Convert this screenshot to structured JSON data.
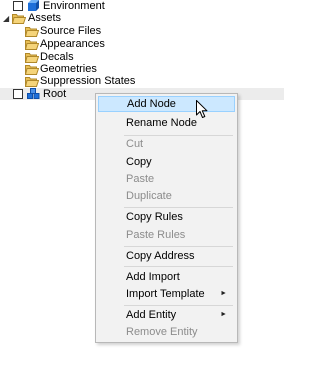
{
  "tree": {
    "environment": {
      "label": "Environment"
    },
    "assets": {
      "label": "Assets",
      "expander": "◢"
    },
    "children": [
      {
        "label": "Source Files"
      },
      {
        "label": "Appearances"
      },
      {
        "label": "Decals"
      },
      {
        "label": "Geometries"
      },
      {
        "label": "Suppression States"
      }
    ],
    "root": {
      "label": "Root"
    }
  },
  "context_menu": {
    "add_node": "Add Node",
    "rename_node": "Rename Node",
    "cut": "Cut",
    "copy": "Copy",
    "paste": "Paste",
    "duplicate": "Duplicate",
    "copy_rules": "Copy Rules",
    "paste_rules": "Paste Rules",
    "copy_address": "Copy Address",
    "add_import": "Add Import",
    "import_template": "Import Template",
    "add_entity": "Add Entity",
    "remove_entity": "Remove Entity",
    "submenu_arrow": "►"
  },
  "colors": {
    "hover_bg": "#cce8ff",
    "hover_border": "#99d1ff",
    "menu_bg": "#f2f2f2",
    "disabled_text": "#8c8c8c",
    "folder_fill": "#f5d47a",
    "cube_blue": "#1e6fd9"
  }
}
